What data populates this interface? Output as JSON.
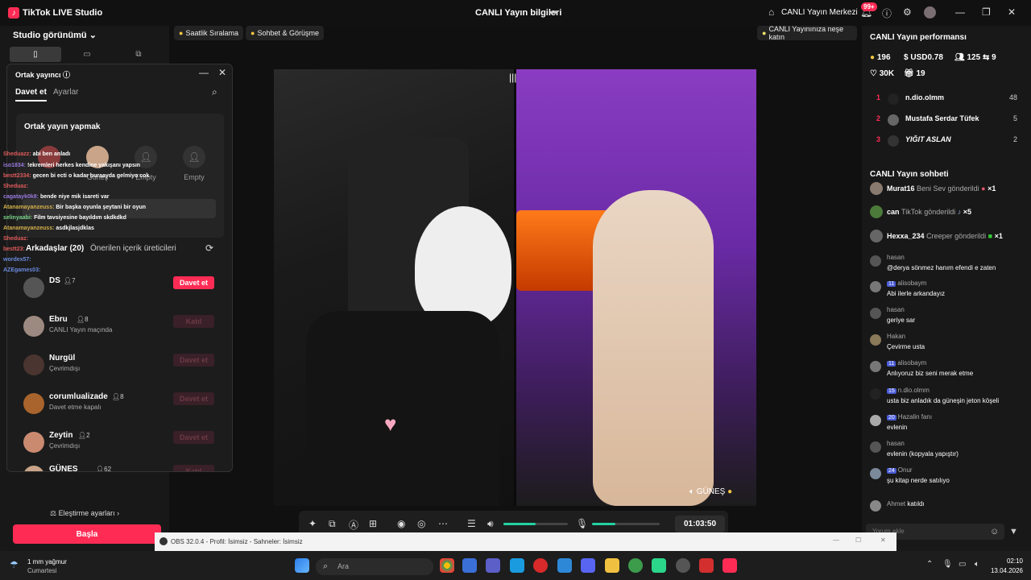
{
  "titlebar": {
    "app_title": "TikTok LIVE Studio",
    "center_title": "CANLI Yayın bilgileri",
    "live_center": "CANLI Yayın Merkezi",
    "notif_badge": "99+"
  },
  "left": {
    "view_label": "Studio görünümü",
    "critique_settings": "Eleştirme ayarları",
    "start_button": "Başla"
  },
  "chips": {
    "hourly_ranking": "Saatlik Sıralama",
    "chat_meet": "Sohbet & Görüşme",
    "fun_tip": "CANLI Yayınınıza neşe katın"
  },
  "cohost": {
    "title": "Ortak yayıncı",
    "tab_invite": "Davet et",
    "tab_settings": "Ayarlar",
    "card_title": "Ortak yayın yapmak",
    "slots": [
      "Güneş",
      "Empty",
      "Empty"
    ],
    "friends_tab": "Arkadaşlar (20)",
    "suggested_tab": "Önerilen içerik üreticileri",
    "rows": [
      {
        "name": "DS",
        "count": "7",
        "status": "",
        "button": "Davet et"
      },
      {
        "name": "Ebru",
        "count": "8",
        "status": "CANLI Yayın maçında",
        "button": "Katıl"
      },
      {
        "name": "Nurgül",
        "count": "",
        "status": "Çevrimdışı",
        "button": "Davet et"
      },
      {
        "name": "corumlualizade",
        "count": "8",
        "status": "Davet etme kapalı",
        "button": "Davet et"
      },
      {
        "name": "Zeytin",
        "count": "2",
        "status": "Çevrimdışı",
        "button": "Davet et"
      },
      {
        "name": "GÜNEŞ",
        "count": "62",
        "status": "",
        "button": "Katıl"
      }
    ]
  },
  "overlay_chat": [
    {
      "user": "Sheduazz:",
      "text": "abi ben anladı"
    },
    {
      "user": "iso1834:",
      "text": "!ekremleri herkes kendine yakışanı yapsın"
    },
    {
      "user": "bestt2334:",
      "text": "gecen bi ecti o kadar buraayda gelmiyo cok"
    },
    {
      "user": "Sheduaz:",
      "text": "..."
    },
    {
      "user": "cagatayk0k8:",
      "text": "bende niye mik isareti var"
    },
    {
      "user": "Atanamayanzeuss:",
      "text": "Bir başka oyunla şeytani bir oyun"
    },
    {
      "user": "selinyaabi:",
      "text": "Film tavsiyesine bayıldım skdkdkd"
    },
    {
      "user": "Atanamayanzeuss:",
      "text": "asdkjlasjdklas"
    },
    {
      "user": "Sheduaz:",
      "text": ""
    },
    {
      "user": "bestt23:",
      "text": ""
    },
    {
      "user": "wordex57:",
      "text": ""
    },
    {
      "user": "AZEgames03:",
      "text": ""
    }
  ],
  "video": {
    "guest_name": "GÜNEŞ",
    "timer": "01:03:50",
    "mic_level": 0.35,
    "volume_level": 0.5
  },
  "performance": {
    "title": "CANLI Yayın performansı",
    "coins": "196",
    "usd": "USD0.78",
    "viewers": "125",
    "shares": "9",
    "likes": "30K",
    "gifts": "19",
    "ranking": [
      {
        "rank": "1",
        "name": "n.dio.olmm",
        "value": "48"
      },
      {
        "rank": "2",
        "name": "Mustafa Serdar Tüfek",
        "value": "5"
      },
      {
        "rank": "3",
        "name": "YIĞIT ASLAN",
        "value": "2"
      }
    ]
  },
  "chat": {
    "title": "CANLI Yayın sohbeti",
    "gifts": [
      {
        "name": "Murat16",
        "text": "Beni Sev gönderildi",
        "count": "×1"
      },
      {
        "name": "can",
        "text": "TikTok gönderildi",
        "count": "×5"
      },
      {
        "name": "Hexxa_234",
        "text": "Creeper gönderildi",
        "count": "×1"
      }
    ],
    "messages": [
      {
        "user": "hasan",
        "level": "",
        "text": "@derya sönmez hanım efendi e zaten"
      },
      {
        "user": "alisobaym",
        "level": "11",
        "text": "Abi ilerle arkandayız"
      },
      {
        "user": "hasan",
        "level": "",
        "text": "geriye sar"
      },
      {
        "user": "Hakan",
        "level": "",
        "text": "Çevirme usta"
      },
      {
        "user": "alisobaym",
        "level": "11",
        "text": "Anlıyoruz biz seni merak etme"
      },
      {
        "user": "n.dio.olmm",
        "level": "15",
        "text": "usta biz anladık da güneşin jeton köşeli"
      },
      {
        "user": "Hazalin fanı",
        "level": "20",
        "text": "evlenin"
      },
      {
        "user": "hasan",
        "level": "",
        "text": "evlenin (kopyala yapıştır)"
      },
      {
        "user": "Onur",
        "level": "24",
        "text": "şu kitap nerde satılıyo"
      }
    ],
    "joined_user": "Ahmet",
    "joined_text": "katıldı",
    "input_placeholder": "Yorum ekle"
  },
  "obs": {
    "title": "OBS 32.0.4 - Profil: İsimsiz - Sahneler: İsimsiz"
  },
  "taskbar": {
    "weather_line1": "1 mm yağmur",
    "weather_line2": "Cumartesi",
    "search_placeholder": "Ara",
    "time": "02:10",
    "date": "13.04.2026"
  }
}
